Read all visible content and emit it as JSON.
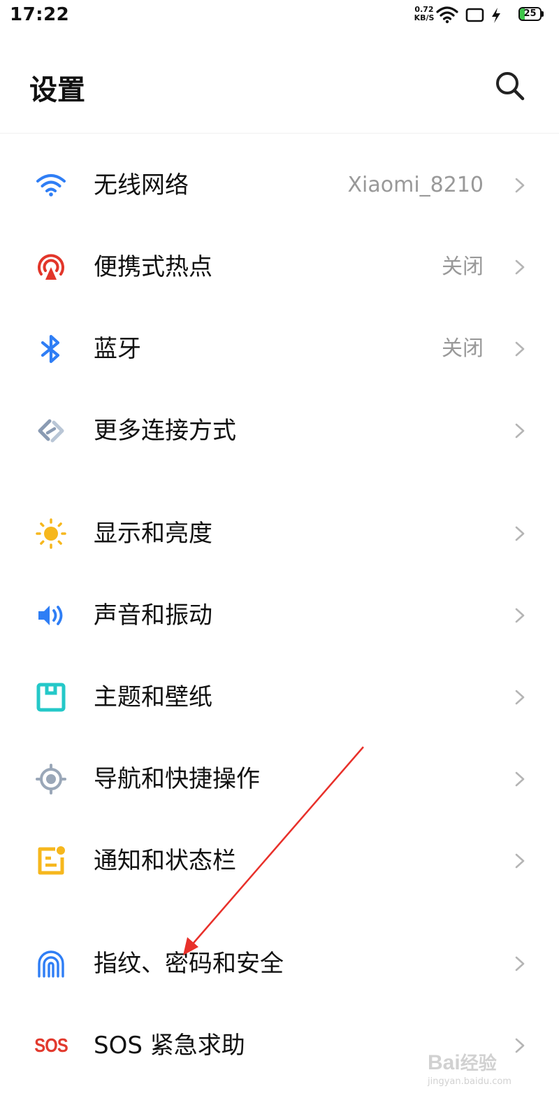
{
  "status_bar": {
    "time": "17:22",
    "net_speed_value": "0.72",
    "net_speed_unit": "KB/S",
    "battery_level": "25",
    "battery_fraction": 0.25,
    "icons": [
      "wifi-icon",
      "screen-rotate-icon",
      "charging-icon",
      "battery-icon"
    ]
  },
  "header": {
    "title": "设置",
    "search_icon": "search-icon"
  },
  "settings": [
    {
      "label": "无线网络",
      "value": "Xiaomi_8210",
      "icon": "wifi-icon",
      "color": "#2f7ef5"
    },
    {
      "label": "便携式热点",
      "value": "关闭",
      "icon": "hotspot-icon",
      "color": "#e2362a"
    },
    {
      "label": "蓝牙",
      "value": "关闭",
      "icon": "bluetooth-icon",
      "color": "#2f7ef5"
    },
    {
      "label": "更多连接方式",
      "value": "",
      "icon": "more-connections-icon",
      "color": "#8a9bb3"
    },
    {
      "label": "显示和亮度",
      "value": "",
      "icon": "brightness-icon",
      "color": "#f6b71d"
    },
    {
      "label": "声音和振动",
      "value": "",
      "icon": "sound-icon",
      "color": "#2f7ef5"
    },
    {
      "label": "主题和壁纸",
      "value": "",
      "icon": "theme-icon",
      "color": "#24c8c8"
    },
    {
      "label": "导航和快捷操作",
      "value": "",
      "icon": "navigation-icon",
      "color": "#9aa7b8"
    },
    {
      "label": "通知和状态栏",
      "value": "",
      "icon": "notification-icon",
      "color": "#f6b71d"
    },
    {
      "label": "指纹、密码和安全",
      "value": "",
      "icon": "fingerprint-icon",
      "color": "#2f7ef5"
    },
    {
      "label": "SOS 紧急求助",
      "value": "",
      "icon": "sos-icon",
      "color": "#e23a2e"
    }
  ],
  "sos_icon_text": "SOS",
  "watermark": {
    "brand": "Bai",
    "brand_cn": "经验",
    "site": "jingyan.baidu.com"
  }
}
